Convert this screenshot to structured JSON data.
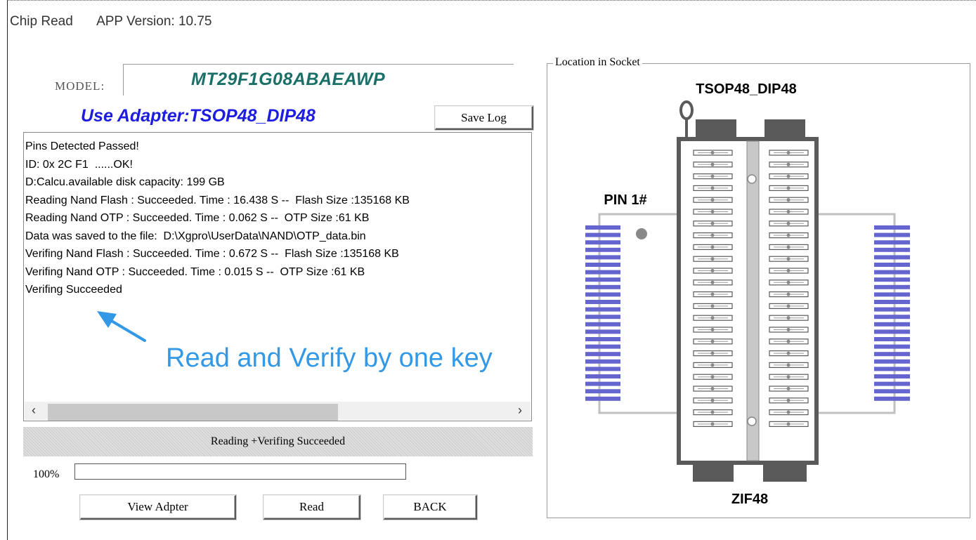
{
  "window": {
    "title": "Chip Read",
    "version": "APP Version: 10.75"
  },
  "model": {
    "label": "MODEL:",
    "value": "MT29F1G08ABAEAWP"
  },
  "adapter": {
    "text": "Use Adapter:TSOP48_DIP48"
  },
  "save_log_button": "Save Log",
  "log": {
    "lines": [
      "Pins Detected Passed!",
      "ID: 0x 2C F1  ......OK!",
      "D:Calcu.available disk capacity: 199 GB",
      "Reading Nand Flash : Succeeded. Time : 16.438 S --  Flash Size :135168 KB",
      "Reading Nand OTP : Succeeded. Time : 0.062 S --  OTP Size :61 KB",
      "Data was saved to the file:  D:\\Xgpro\\UserData\\NAND\\OTP_data.bin",
      "Verifing Nand Flash : Succeeded. Time : 0.672 S --  Flash Size :135168 KB",
      "Verifing Nand OTP : Succeeded. Time : 0.015 S --  OTP Size :61 KB",
      "Verifing Succeeded"
    ],
    "scroll_left_glyph": "‹",
    "scroll_right_glyph": "›"
  },
  "annotation": {
    "text": "Read and Verify by one key",
    "color": "#3399e6"
  },
  "status": {
    "text": "Reading +Verifing  Succeeded"
  },
  "progress": {
    "label": "100%",
    "value": 1.0
  },
  "buttons": {
    "view_adapter": "View Adpter",
    "read": "Read",
    "back": "BACK"
  },
  "socket": {
    "legend": "Location in Socket",
    "adapter_label": "TSOP48_DIP48",
    "pin1_label": "PIN 1#",
    "zif_label": "ZIF48",
    "pins_per_side": 24,
    "pad_color": "#6565d0",
    "body_color": "#5a5a5a"
  }
}
